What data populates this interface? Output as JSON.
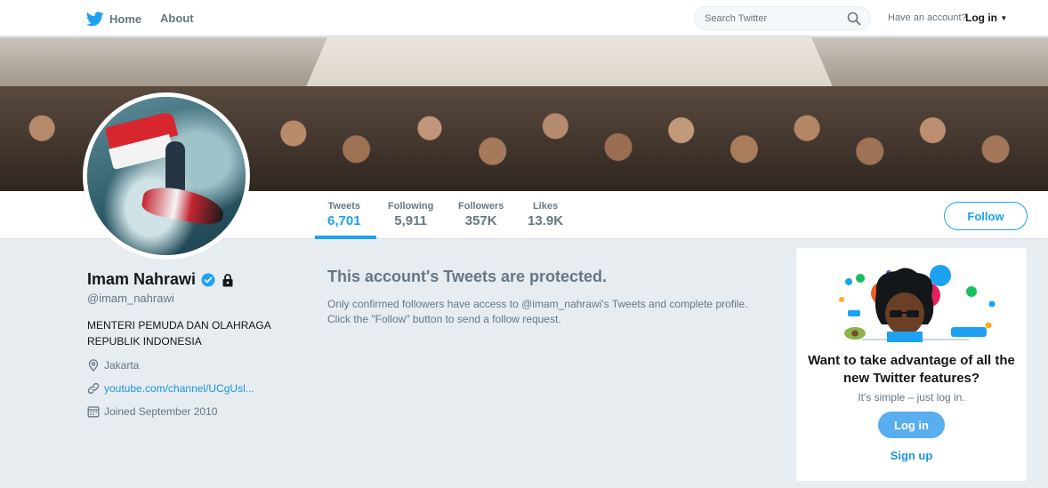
{
  "nav": {
    "home_label": "Home",
    "about_label": "About",
    "search_placeholder": "Search Twitter",
    "have_account_text": "Have an account?",
    "login_label": "Log in",
    "brand_color": "#1da1f2"
  },
  "profile": {
    "name": "Imam Nahrawi",
    "handle": "@imam_nahrawi",
    "bio_line1": "MENTERI PEMUDA DAN OLAHRAGA",
    "bio_line2": "REPUBLIK INDONESIA",
    "location": "Jakarta",
    "website": "youtube.com/channel/UCgUsl...",
    "joined": "Joined September 2010",
    "verified": true,
    "protected": true
  },
  "stats": [
    {
      "label": "Tweets",
      "value": "6,701",
      "active": true
    },
    {
      "label": "Following",
      "value": "5,911",
      "active": false
    },
    {
      "label": "Followers",
      "value": "357K",
      "active": false
    },
    {
      "label": "Likes",
      "value": "13.9K",
      "active": false
    }
  ],
  "follow_label": "Follow",
  "protected_msg": {
    "title": "This account's Tweets are protected.",
    "line1": "Only confirmed followers have access to @imam_nahrawi's Tweets and complete profile.",
    "line2": "Click the \"Follow\" button to send a follow request."
  },
  "signup_card": {
    "title": "Want to take advantage of all the new Twitter features?",
    "subtitle": "It's simple – just log in.",
    "login_label": "Log in",
    "signup_label": "Sign up"
  }
}
